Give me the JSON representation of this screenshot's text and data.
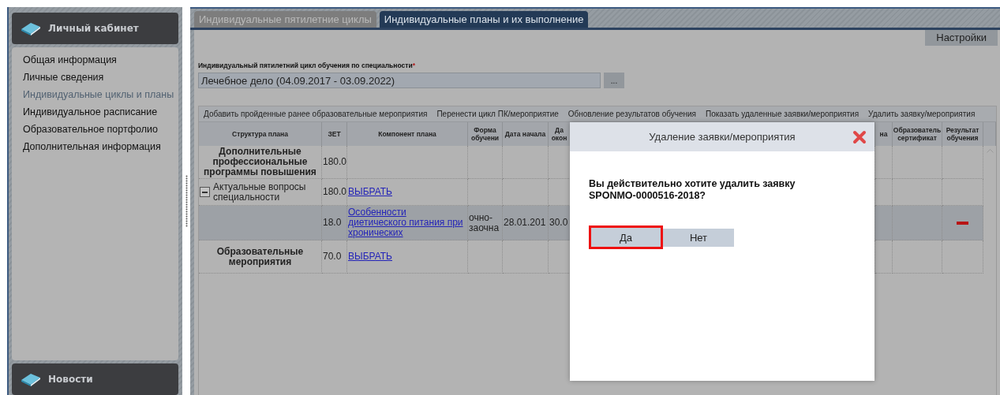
{
  "sidebar": {
    "header": "Личный кабинет",
    "items": [
      {
        "label": "Общая информация",
        "selected": false
      },
      {
        "label": "Личные сведения",
        "selected": false
      },
      {
        "label": "Индивидуальные циклы и планы",
        "selected": true
      },
      {
        "label": "Индивидуальное расписание",
        "selected": false
      },
      {
        "label": "Образовательное портфолио",
        "selected": false
      },
      {
        "label": "Дополнительная информация",
        "selected": false
      }
    ],
    "footer_header": "Новости"
  },
  "tabs": [
    {
      "label": "Индивидуальные пятилетние циклы",
      "selected": false
    },
    {
      "label": "Индивидуальные планы и их выполнение",
      "selected": true
    }
  ],
  "settings_button": "Настройки",
  "cycle_field": {
    "label": "Индивидуальный пятилетний цикл обучения по специальности",
    "required_mark": "*",
    "value": "Лечебное дело (04.09.2017 - 03.09.2022)",
    "browse_button": "..."
  },
  "toolbar": [
    "Добавить пройденные ранее образовательные мероприятия",
    "Перенести цикл ПК/мероприятие",
    "Обновление результатов обучения",
    "Показать удаленные заявки/мероприятия",
    "Удалить заявку/мероприятия"
  ],
  "table": {
    "columns": [
      "Структура плана",
      "ЗЕТ",
      "Компонент плана",
      "Форма обучени",
      "Дата начала",
      "Да окон",
      "на",
      "Образователь сертификат",
      "Результат обучения"
    ],
    "rows": [
      {
        "kind": "group",
        "selected": false,
        "structure": "Дополнительные профессиональные программы повышения",
        "zet": "180.0"
      },
      {
        "kind": "course",
        "selected": false,
        "expanded": true,
        "structure": "Актуальные вопросы специальности",
        "zet": "180.0",
        "component": "ВЫБРАТЬ"
      },
      {
        "kind": "event",
        "selected": true,
        "removed": true,
        "zet": "18.0",
        "component": "Особенности диетического питания при хронических",
        "form": "очно-заочна",
        "start": "28.01.201",
        "end": "30.0"
      },
      {
        "kind": "group",
        "selected": false,
        "structure": "Образовательные мероприятия",
        "zet": "70.0",
        "component": "ВЫБРАТЬ"
      }
    ]
  },
  "dialog": {
    "title": "Удаление заявки/мероприятия",
    "message": "Вы действительно хотите удалить заявку SPONMO-0000516-2018?",
    "buttons": [
      {
        "label": "Да",
        "focused": true
      },
      {
        "label": "Нет",
        "focused": false
      }
    ]
  }
}
